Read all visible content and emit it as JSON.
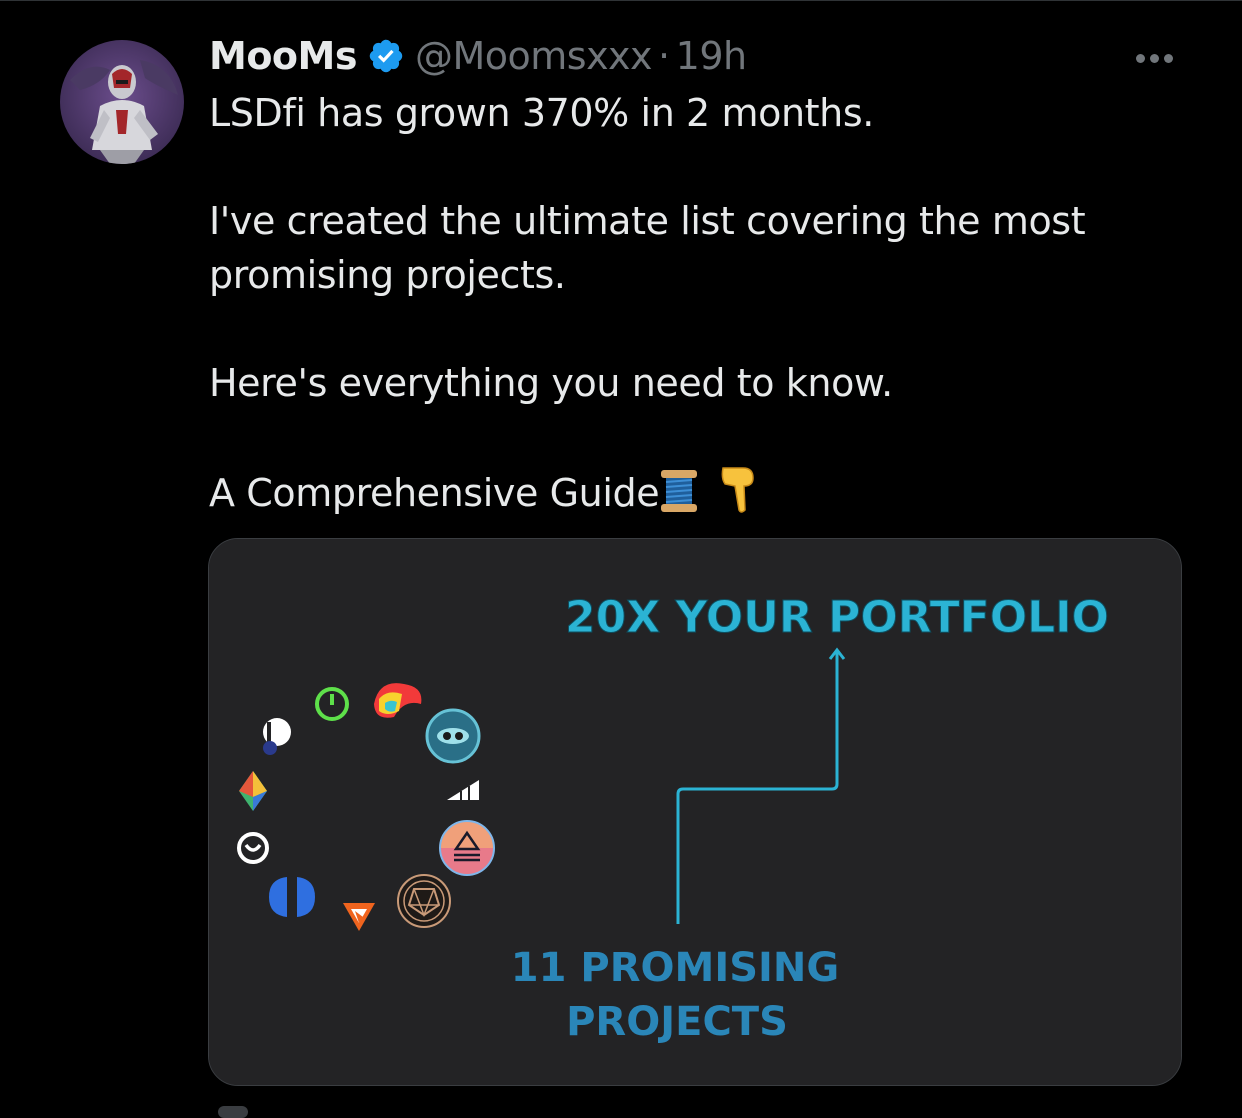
{
  "tweet": {
    "author": {
      "display_name": "MooMs",
      "verified": true,
      "handle": "@Moomsxxx",
      "separator": "·",
      "time": "19h"
    },
    "text": {
      "line1": "LSDfi has grown 370% in 2 months.",
      "line2": "I've created the ultimate list covering the most promising projects.",
      "line3": "Here's everything you need to know.",
      "line4": "A Comprehensive Guide"
    },
    "emojis": [
      "spool-of-thread-emoji",
      "backhand-index-pointing-down-emoji"
    ],
    "media": {
      "headline": "20X YOUR PORTFOLIO",
      "subline1": "11 PROMISING",
      "subline2": "PROJECTS",
      "logo_count": 11
    }
  },
  "colors": {
    "background": "#000000",
    "text_primary": "#e7e9ea",
    "text_secondary": "#71767b",
    "verified_blue": "#1d9bf0",
    "media_background": "#232325",
    "media_accent": "#2bb3d4"
  }
}
